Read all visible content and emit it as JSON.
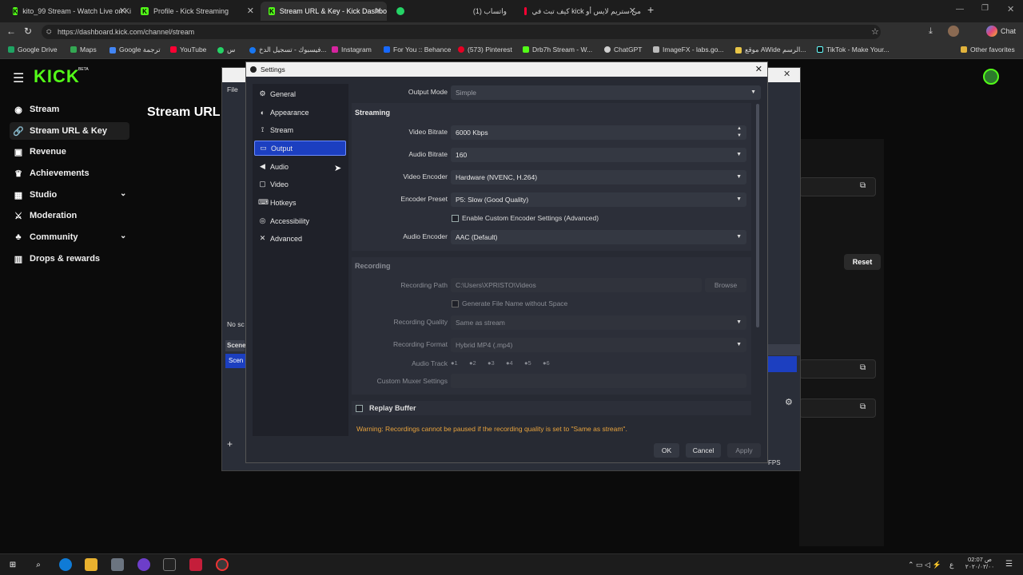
{
  "browser": {
    "tabs": [
      {
        "label": "kito_99 Stream - Watch Live on Ki"
      },
      {
        "label": "Profile - Kick Streaming"
      },
      {
        "label": "Stream URL & Key - Kick Dashbo"
      },
      {
        "label": ""
      },
      {
        "label": "واتساب (1)"
      },
      {
        "label": "كيف تبث في kick من ستريم لايس أو"
      }
    ],
    "url": "https://dashboard.kick.com/channel/stream",
    "bookmarks": [
      "Google Drive",
      "Maps",
      "Google ترجمة",
      "YouTube",
      "س",
      "فيسبوك - تسجيل الدخ...",
      "Instagram",
      "For You :: Behance",
      "(573) Pinterest",
      "Drb7h Stream - W...",
      "ChatGPT",
      "ImageFX - labs.go...",
      "موقع AWide الرسم...",
      "TikTok - Make Your...",
      "Other favorites"
    ],
    "chat_label": "Chat"
  },
  "kick": {
    "logo": "KICK",
    "logo_badge": "BETA",
    "page_title": "Stream URL",
    "sidebar": [
      {
        "label": "Stream",
        "icon": "broadcast-icon"
      },
      {
        "label": "Stream URL & Key",
        "icon": "link-icon"
      },
      {
        "label": "Revenue",
        "icon": "dollar-icon"
      },
      {
        "label": "Achievements",
        "icon": "trophy-icon"
      },
      {
        "label": "Studio",
        "icon": "studio-icon"
      },
      {
        "label": "Moderation",
        "icon": "sword-icon"
      },
      {
        "label": "Community",
        "icon": "people-icon"
      },
      {
        "label": "Drops & rewards",
        "icon": "gift-icon"
      }
    ],
    "reset_label": "Reset"
  },
  "obs_back": {
    "file_menu": "File",
    "no_scene": "No sc",
    "scenes_header": "Scene",
    "scene_item": "Scen",
    "fps": "FPS"
  },
  "settings": {
    "title": "Settings",
    "nav": [
      {
        "label": "General",
        "icon": "gear-icon"
      },
      {
        "label": "Appearance",
        "icon": "palette-icon"
      },
      {
        "label": "Stream",
        "icon": "antenna-icon"
      },
      {
        "label": "Output",
        "icon": "monitor-icon"
      },
      {
        "label": "Audio",
        "icon": "speaker-icon"
      },
      {
        "label": "Video",
        "icon": "screen-icon"
      },
      {
        "label": "Hotkeys",
        "icon": "keyboard-icon"
      },
      {
        "label": "Accessibility",
        "icon": "accessibility-icon"
      },
      {
        "label": "Advanced",
        "icon": "wrench-icon"
      }
    ],
    "output_mode_label": "Output Mode",
    "output_mode_value": "Simple",
    "streaming_header": "Streaming",
    "video_bitrate_label": "Video Bitrate",
    "video_bitrate_value": "6000 Kbps",
    "audio_bitrate_label": "Audio Bitrate",
    "audio_bitrate_value": "160",
    "video_encoder_label": "Video Encoder",
    "video_encoder_value": "Hardware (NVENC, H.264)",
    "encoder_preset_label": "Encoder Preset",
    "encoder_preset_value": "P5: Slow (Good Quality)",
    "custom_encoder_label": "Enable Custom Encoder Settings (Advanced)",
    "audio_encoder_label": "Audio Encoder",
    "audio_encoder_value": "AAC (Default)",
    "recording_header": "Recording",
    "recording_path_label": "Recording Path",
    "recording_path_value": "C:\\Users\\XPRISTO\\Videos",
    "browse_label": "Browse",
    "gen_filename_label": "Generate File Name without Space",
    "recording_quality_label": "Recording Quality",
    "recording_quality_value": "Same as stream",
    "recording_format_label": "Recording Format",
    "recording_format_value": "Hybrid MP4 (.mp4)",
    "audio_track_label": "Audio Track",
    "audio_tracks": [
      "1",
      "2",
      "3",
      "4",
      "5",
      "6"
    ],
    "custom_muxer_label": "Custom Muxer Settings",
    "replay_buffer_label": "Replay Buffer",
    "warning": "Warning: Recordings cannot be paused if the recording quality is set to \"Same as stream\".",
    "ok_label": "OK",
    "cancel_label": "Cancel",
    "apply_label": "Apply"
  },
  "taskbar": {
    "time": "02:07 ص",
    "date": "۲۰۲۰/۰۲/۰۰",
    "lang": "ع"
  },
  "colors": {
    "kick_green": "#53fc18",
    "selection_blue": "#1c3fc0",
    "warning_orange": "#e8a33d"
  }
}
